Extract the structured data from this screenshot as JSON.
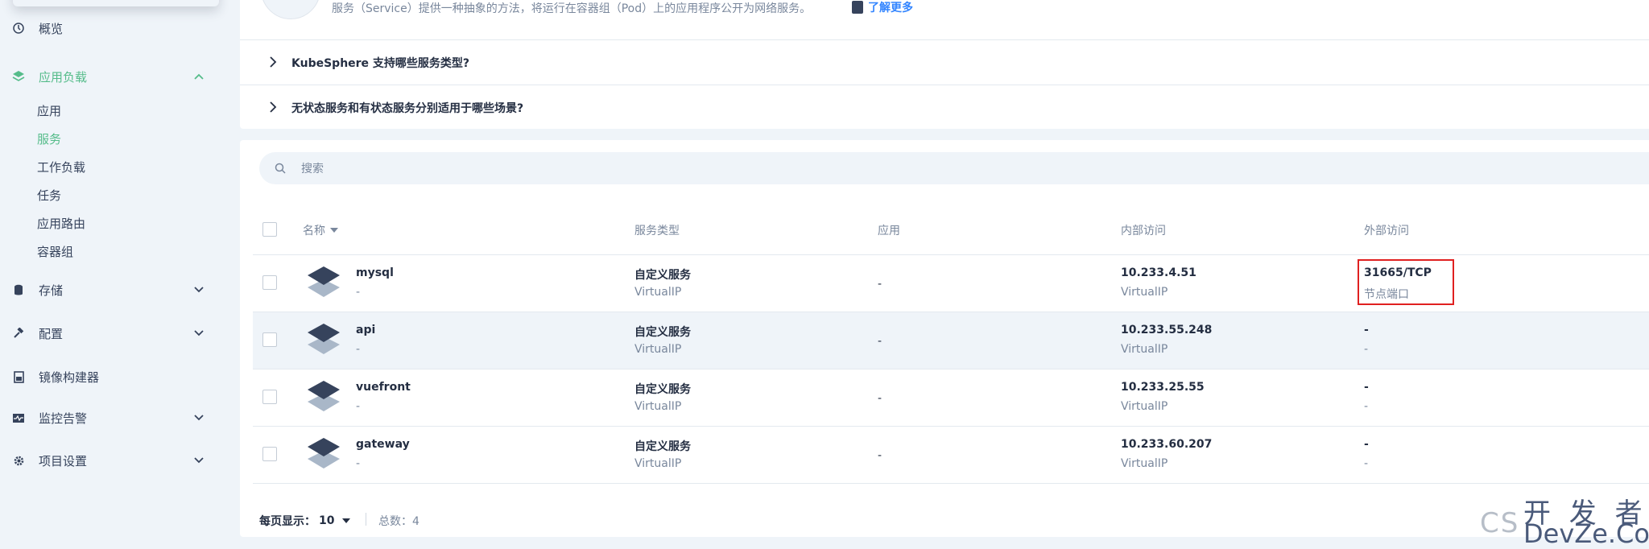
{
  "sidebar": {
    "items": [
      {
        "label": "概览",
        "icon": "dashboard-icon"
      },
      {
        "label": "应用负载",
        "icon": "layers-icon",
        "expanded": true
      },
      {
        "label": "存储",
        "icon": "storage-icon"
      },
      {
        "label": "配置",
        "icon": "hammer-icon"
      },
      {
        "label": "镜像构建器",
        "icon": "image-builder-icon"
      },
      {
        "label": "监控告警",
        "icon": "monitor-icon"
      },
      {
        "label": "项目设置",
        "icon": "gear-icon"
      }
    ],
    "sub_items": [
      "应用",
      "服务",
      "工作负载",
      "任务",
      "应用路由",
      "容器组"
    ],
    "active_sub": "服务"
  },
  "banner": {
    "description": "服务（Service）提供一种抽象的方法，将运行在容器组（Pod）上的应用程序公开为网络服务。",
    "learn_more": "了解更多"
  },
  "faq": [
    "KubeSphere 支持哪些服务类型?",
    "无状态服务和有状态服务分别适用于哪些场景?"
  ],
  "search": {
    "placeholder": "搜索"
  },
  "table": {
    "columns": [
      "名称",
      "服务类型",
      "应用",
      "内部访问",
      "外部访问"
    ],
    "rows": [
      {
        "name": "mysql",
        "name_sub": "-",
        "type": "自定义服务",
        "type_sub": "VirtualIP",
        "app": "-",
        "internal": "10.233.4.51",
        "internal_sub": "VirtualIP",
        "external": "31665/TCP",
        "external_sub": "节点端口"
      },
      {
        "name": "api",
        "name_sub": "-",
        "type": "自定义服务",
        "type_sub": "VirtualIP",
        "app": "-",
        "internal": "10.233.55.248",
        "internal_sub": "VirtualIP",
        "external": "-",
        "external_sub": "-"
      },
      {
        "name": "vuefront",
        "name_sub": "-",
        "type": "自定义服务",
        "type_sub": "VirtualIP",
        "app": "-",
        "internal": "10.233.25.55",
        "internal_sub": "VirtualIP",
        "external": "-",
        "external_sub": "-"
      },
      {
        "name": "gateway",
        "name_sub": "-",
        "type": "自定义服务",
        "type_sub": "VirtualIP",
        "app": "-",
        "internal": "10.233.60.207",
        "internal_sub": "VirtualIP",
        "external": "-",
        "external_sub": "-"
      }
    ]
  },
  "pagination": {
    "per_page_label": "每页显示：",
    "per_page_value": "10",
    "total": "总数：4"
  },
  "watermark": {
    "line1": "开 发 者",
    "line2": "DevZe.CoM",
    "faded": "CS"
  },
  "colors": {
    "accent": "#55bc8a",
    "highlight": "#e02020",
    "text": "#242e42",
    "muted": "#79879c"
  }
}
